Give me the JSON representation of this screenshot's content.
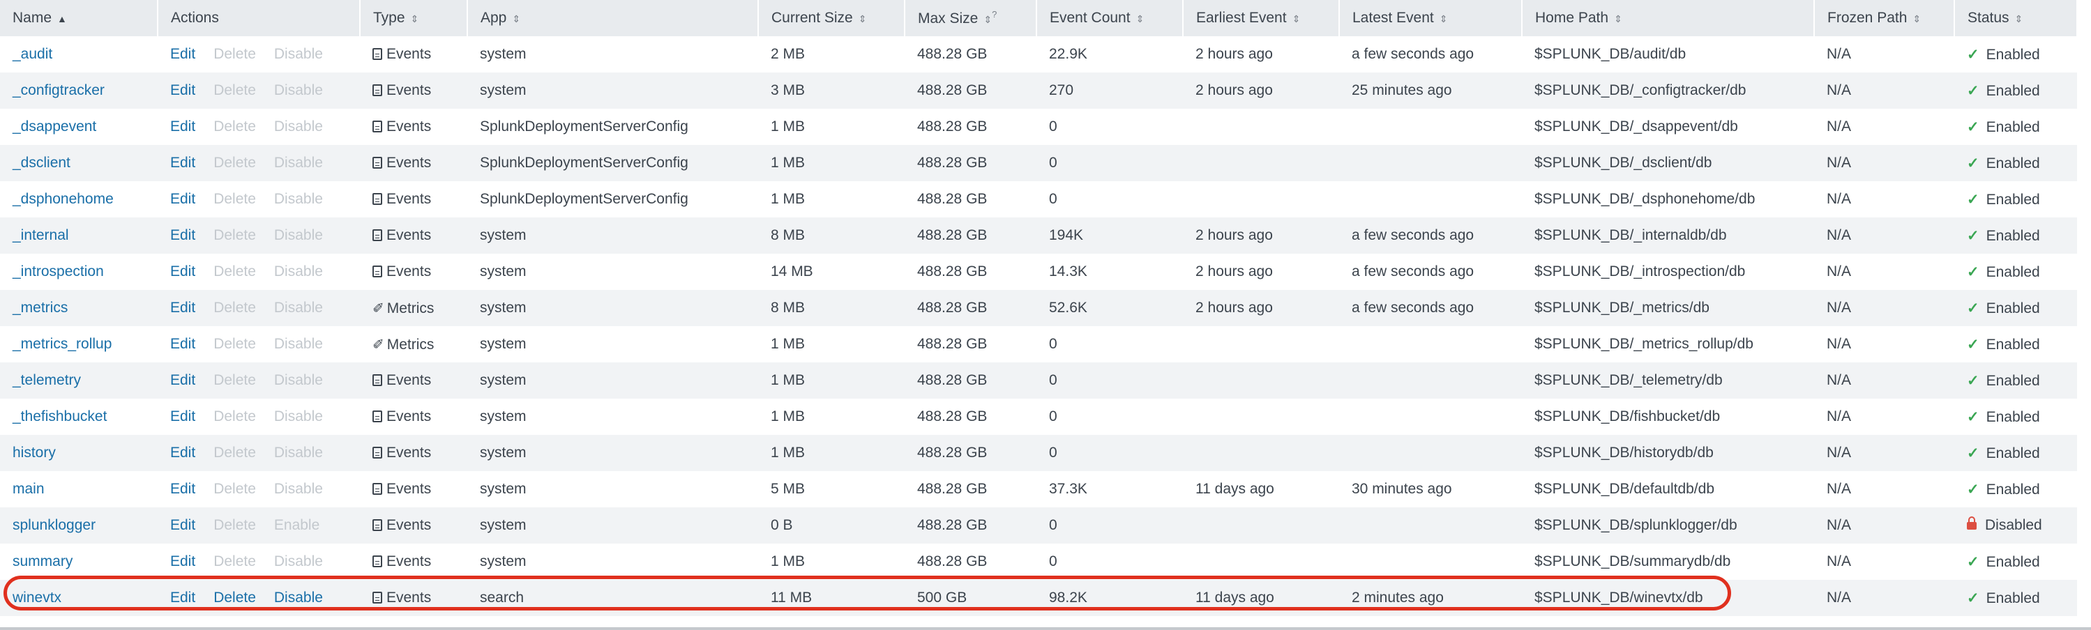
{
  "columns": {
    "name": "Name",
    "actions": "Actions",
    "type": "Type",
    "app": "App",
    "current_size": "Current Size",
    "max_size": "Max Size",
    "max_size_help": "?",
    "event_count": "Event Count",
    "earliest_event": "Earliest Event",
    "latest_event": "Latest Event",
    "home_path": "Home Path",
    "frozen_path": "Frozen Path",
    "status": "Status"
  },
  "sort_glyphs": {
    "ascending": "▲",
    "sortable": "⇕"
  },
  "action_labels": {
    "edit": "Edit",
    "delete": "Delete",
    "disable": "Disable",
    "enable": "Enable"
  },
  "rows": [
    {
      "name": "_audit",
      "enable_action": "Disable",
      "actions_active": false,
      "type": "Events",
      "type_icon": "events-icon",
      "app": "system",
      "current_size": "2 MB",
      "max_size": "488.28 GB",
      "event_count": "22.9K",
      "earliest_event": "2 hours ago",
      "latest_event": "a few seconds ago",
      "home_path": "$SPLUNK_DB/audit/db",
      "frozen_path": "N/A",
      "status": "Enabled"
    },
    {
      "name": "_configtracker",
      "enable_action": "Disable",
      "actions_active": false,
      "type": "Events",
      "type_icon": "events-icon",
      "app": "system",
      "current_size": "3 MB",
      "max_size": "488.28 GB",
      "event_count": "270",
      "earliest_event": "2 hours ago",
      "latest_event": "25 minutes ago",
      "home_path": "$SPLUNK_DB/_configtracker/db",
      "frozen_path": "N/A",
      "status": "Enabled"
    },
    {
      "name": "_dsappevent",
      "enable_action": "Disable",
      "actions_active": false,
      "type": "Events",
      "type_icon": "events-icon",
      "app": "SplunkDeploymentServerConfig",
      "current_size": "1 MB",
      "max_size": "488.28 GB",
      "event_count": "0",
      "earliest_event": "",
      "latest_event": "",
      "home_path": "$SPLUNK_DB/_dsappevent/db",
      "frozen_path": "N/A",
      "status": "Enabled"
    },
    {
      "name": "_dsclient",
      "enable_action": "Disable",
      "actions_active": false,
      "type": "Events",
      "type_icon": "events-icon",
      "app": "SplunkDeploymentServerConfig",
      "current_size": "1 MB",
      "max_size": "488.28 GB",
      "event_count": "0",
      "earliest_event": "",
      "latest_event": "",
      "home_path": "$SPLUNK_DB/_dsclient/db",
      "frozen_path": "N/A",
      "status": "Enabled"
    },
    {
      "name": "_dsphonehome",
      "enable_action": "Disable",
      "actions_active": false,
      "type": "Events",
      "type_icon": "events-icon",
      "app": "SplunkDeploymentServerConfig",
      "current_size": "1 MB",
      "max_size": "488.28 GB",
      "event_count": "0",
      "earliest_event": "",
      "latest_event": "",
      "home_path": "$SPLUNK_DB/_dsphonehome/db",
      "frozen_path": "N/A",
      "status": "Enabled"
    },
    {
      "name": "_internal",
      "enable_action": "Disable",
      "actions_active": false,
      "type": "Events",
      "type_icon": "events-icon",
      "app": "system",
      "current_size": "8 MB",
      "max_size": "488.28 GB",
      "event_count": "194K",
      "earliest_event": "2 hours ago",
      "latest_event": "a few seconds ago",
      "home_path": "$SPLUNK_DB/_internaldb/db",
      "frozen_path": "N/A",
      "status": "Enabled"
    },
    {
      "name": "_introspection",
      "enable_action": "Disable",
      "actions_active": false,
      "type": "Events",
      "type_icon": "events-icon",
      "app": "system",
      "current_size": "14 MB",
      "max_size": "488.28 GB",
      "event_count": "14.3K",
      "earliest_event": "2 hours ago",
      "latest_event": "a few seconds ago",
      "home_path": "$SPLUNK_DB/_introspection/db",
      "frozen_path": "N/A",
      "status": "Enabled"
    },
    {
      "name": "_metrics",
      "enable_action": "Disable",
      "actions_active": false,
      "type": "Metrics",
      "type_icon": "metrics-icon",
      "app": "system",
      "current_size": "8 MB",
      "max_size": "488.28 GB",
      "event_count": "52.6K",
      "earliest_event": "2 hours ago",
      "latest_event": "a few seconds ago",
      "home_path": "$SPLUNK_DB/_metrics/db",
      "frozen_path": "N/A",
      "status": "Enabled"
    },
    {
      "name": "_metrics_rollup",
      "enable_action": "Disable",
      "actions_active": false,
      "type": "Metrics",
      "type_icon": "metrics-icon",
      "app": "system",
      "current_size": "1 MB",
      "max_size": "488.28 GB",
      "event_count": "0",
      "earliest_event": "",
      "latest_event": "",
      "home_path": "$SPLUNK_DB/_metrics_rollup/db",
      "frozen_path": "N/A",
      "status": "Enabled"
    },
    {
      "name": "_telemetry",
      "enable_action": "Disable",
      "actions_active": false,
      "type": "Events",
      "type_icon": "events-icon",
      "app": "system",
      "current_size": "1 MB",
      "max_size": "488.28 GB",
      "event_count": "0",
      "earliest_event": "",
      "latest_event": "",
      "home_path": "$SPLUNK_DB/_telemetry/db",
      "frozen_path": "N/A",
      "status": "Enabled"
    },
    {
      "name": "_thefishbucket",
      "enable_action": "Disable",
      "actions_active": false,
      "type": "Events",
      "type_icon": "events-icon",
      "app": "system",
      "current_size": "1 MB",
      "max_size": "488.28 GB",
      "event_count": "0",
      "earliest_event": "",
      "latest_event": "",
      "home_path": "$SPLUNK_DB/fishbucket/db",
      "frozen_path": "N/A",
      "status": "Enabled"
    },
    {
      "name": "history",
      "enable_action": "Disable",
      "actions_active": false,
      "type": "Events",
      "type_icon": "events-icon",
      "app": "system",
      "current_size": "1 MB",
      "max_size": "488.28 GB",
      "event_count": "0",
      "earliest_event": "",
      "latest_event": "",
      "home_path": "$SPLUNK_DB/historydb/db",
      "frozen_path": "N/A",
      "status": "Enabled"
    },
    {
      "name": "main",
      "enable_action": "Disable",
      "actions_active": false,
      "type": "Events",
      "type_icon": "events-icon",
      "app": "system",
      "current_size": "5 MB",
      "max_size": "488.28 GB",
      "event_count": "37.3K",
      "earliest_event": "11 days ago",
      "latest_event": "30 minutes ago",
      "home_path": "$SPLUNK_DB/defaultdb/db",
      "frozen_path": "N/A",
      "status": "Enabled"
    },
    {
      "name": "splunklogger",
      "enable_action": "Enable",
      "actions_active": false,
      "type": "Events",
      "type_icon": "events-icon",
      "app": "system",
      "current_size": "0 B",
      "max_size": "488.28 GB",
      "event_count": "0",
      "earliest_event": "",
      "latest_event": "",
      "home_path": "$SPLUNK_DB/splunklogger/db",
      "frozen_path": "N/A",
      "status": "Disabled"
    },
    {
      "name": "summary",
      "enable_action": "Disable",
      "actions_active": false,
      "type": "Events",
      "type_icon": "events-icon",
      "app": "system",
      "current_size": "1 MB",
      "max_size": "488.28 GB",
      "event_count": "0",
      "earliest_event": "",
      "latest_event": "",
      "home_path": "$SPLUNK_DB/summarydb/db",
      "frozen_path": "N/A",
      "status": "Enabled"
    },
    {
      "name": "winevtx",
      "enable_action": "Disable",
      "actions_active": true,
      "type": "Events",
      "type_icon": "events-icon",
      "app": "search",
      "current_size": "11 MB",
      "max_size": "500 GB",
      "event_count": "98.2K",
      "earliest_event": "11 days ago",
      "latest_event": "2 minutes ago",
      "home_path": "$SPLUNK_DB/winevtx/db",
      "frozen_path": "N/A",
      "status": "Enabled"
    }
  ],
  "colors": {
    "link": "#1a6fa8",
    "disabled_action": "#c3c8cd",
    "enabled_status": "#3aa653",
    "disabled_status": "#dc4e41",
    "highlight_outline": "#e0301e",
    "header_bg": "#e8ebee"
  }
}
